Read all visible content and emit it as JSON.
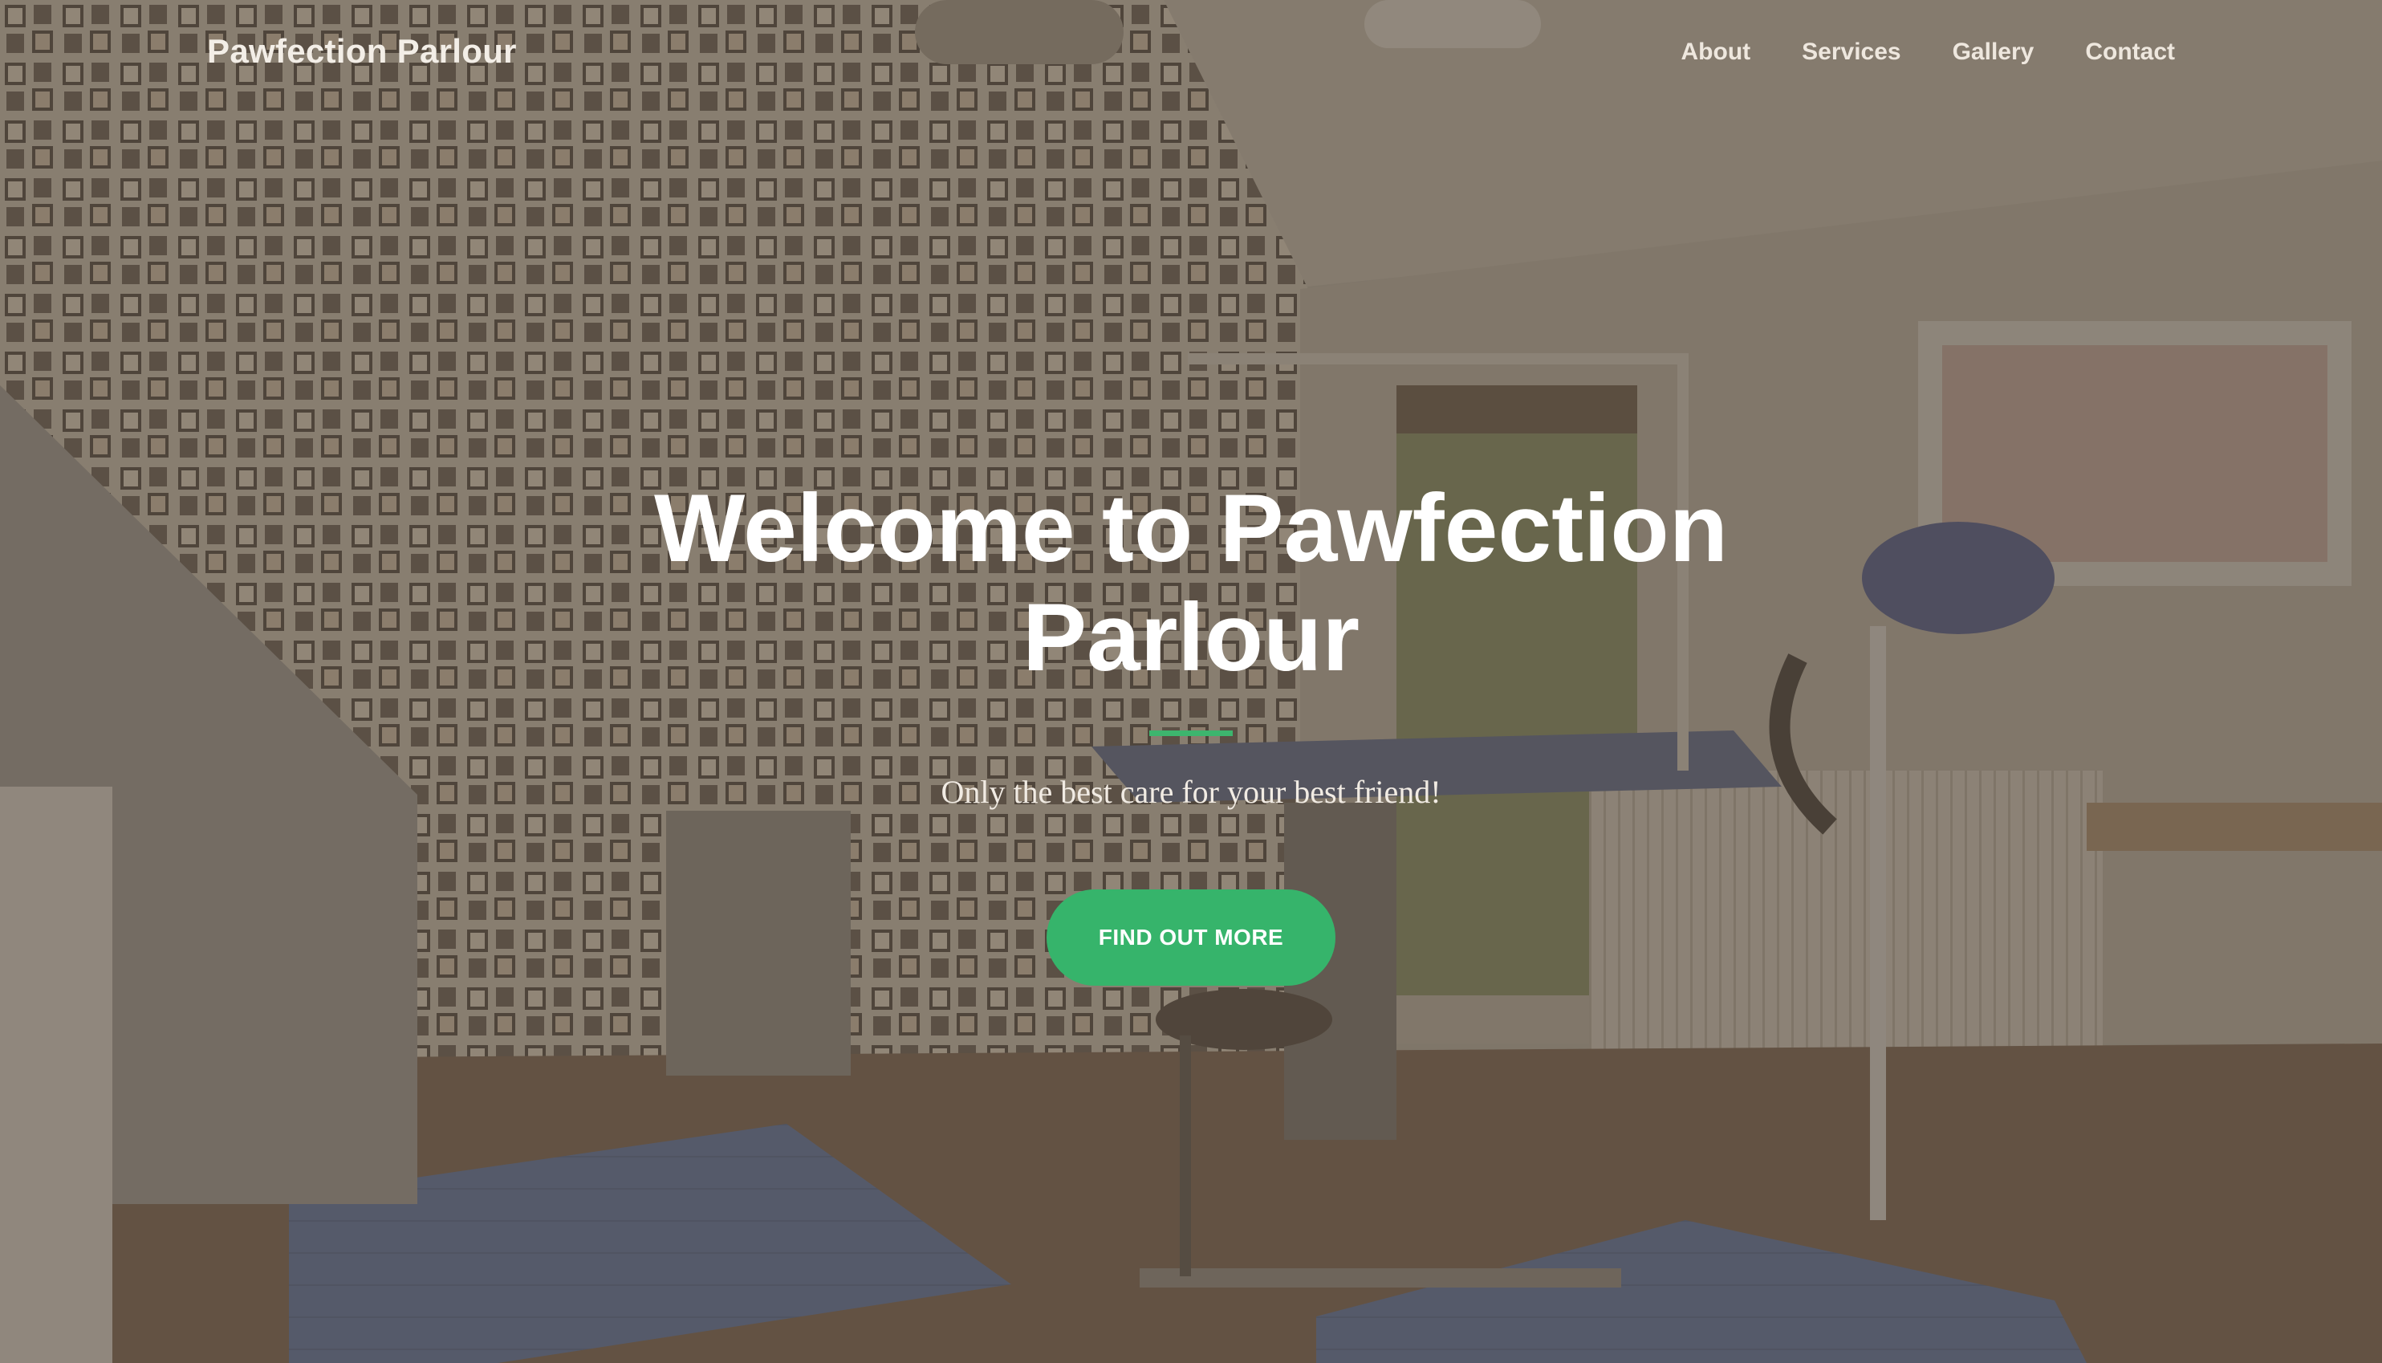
{
  "navbar": {
    "brand": "Pawfection Parlour",
    "links": [
      {
        "label": "About"
      },
      {
        "label": "Services"
      },
      {
        "label": "Gallery"
      },
      {
        "label": "Contact"
      }
    ]
  },
  "hero": {
    "title": "Welcome to Pawfection Parlour",
    "subtitle": "Only the best care for your best friend!",
    "cta_label": "FIND OUT MORE"
  },
  "colors": {
    "accent": "#36b46b",
    "overlay": "#5c5044"
  }
}
